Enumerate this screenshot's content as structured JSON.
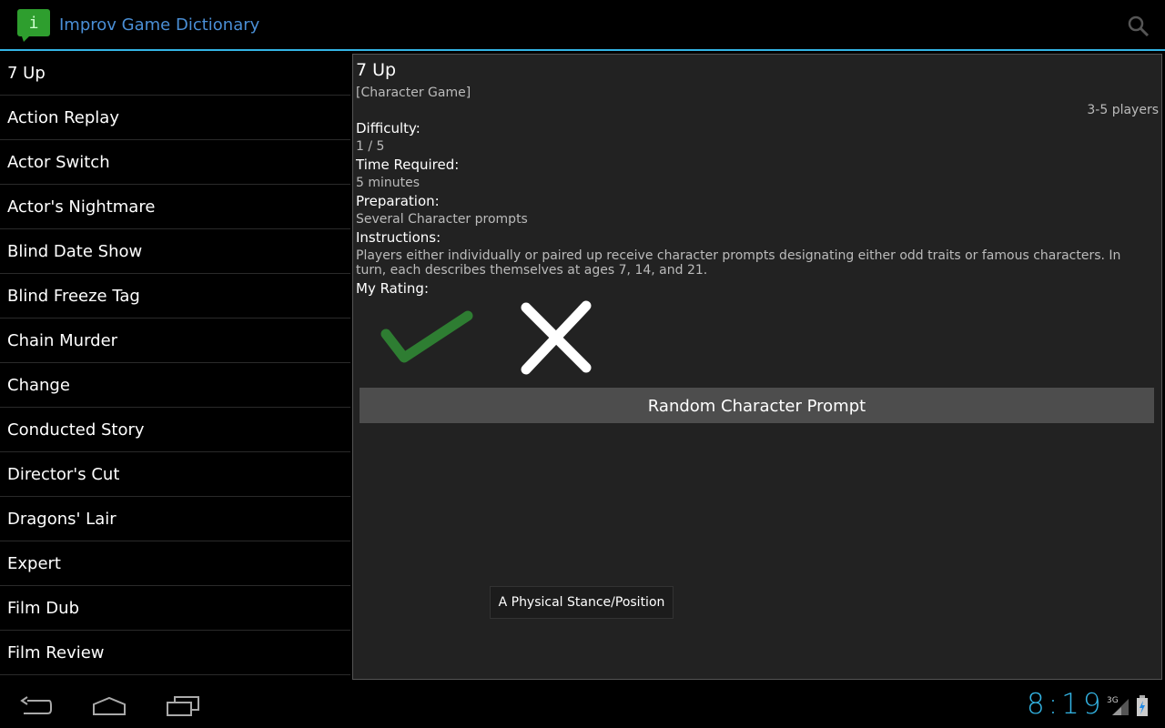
{
  "app": {
    "title": "Improv Game Dictionary",
    "icon": "app-logo-icon",
    "brand_color": "#2e9e2e"
  },
  "games": [
    "7 Up",
    "Action Replay",
    "Actor Switch",
    "Actor's Nightmare",
    "Blind Date Show",
    "Blind Freeze Tag",
    "Chain Murder",
    "Change",
    "Conducted Story",
    "Director's Cut",
    "Dragons' Lair",
    "Expert",
    "Film Dub",
    "Film Review"
  ],
  "detail": {
    "title": "7 Up",
    "category": "[Character Game]",
    "players": "3-5 players",
    "difficulty_label": "Difficulty:",
    "difficulty_value": "1 / 5",
    "time_label": "Time Required:",
    "time_value": "5 minutes",
    "prep_label": "Preparation:",
    "prep_value": "Several Character prompts",
    "instructions_label": "Instructions:",
    "instructions_value": "Players either individually or paired up receive character prompts designating either odd traits or famous characters. In turn, each describes themselves at ages 7, 14, and 21.",
    "rating_label": "My Rating:",
    "prompt_button": "Random Character Prompt",
    "toast": "A Physical Stance/Position"
  },
  "status": {
    "clock": "8:19",
    "network": "3G"
  },
  "colors": {
    "accent": "#33b5e5",
    "check": "#2e7d32"
  }
}
